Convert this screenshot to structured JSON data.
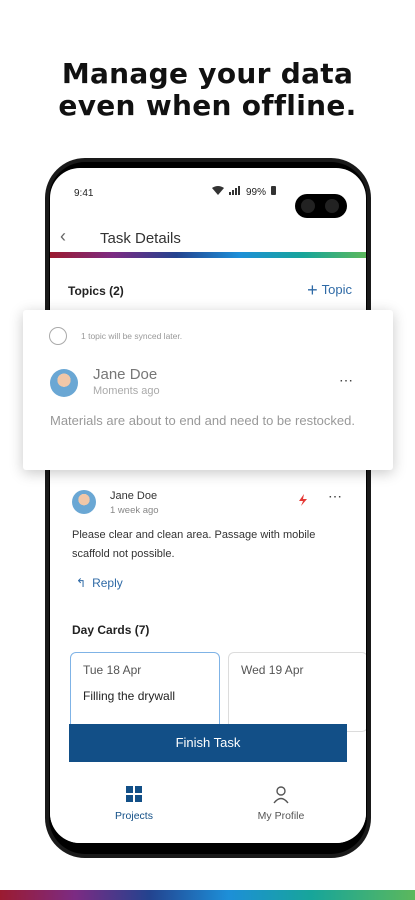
{
  "headline": {
    "line1": "Manage your data",
    "line2": "even when offline."
  },
  "status": {
    "time": "9:41",
    "battery": "99%"
  },
  "appbar": {
    "title": "Task Details"
  },
  "topics": {
    "label": "Topics (2)",
    "add_label": "Topic"
  },
  "offline_comment": {
    "sync_notice": "1 topic will be synced later.",
    "author": "Jane Doe",
    "time": "Moments ago",
    "text": "Materials are about to end and need to be restocked."
  },
  "comment": {
    "author": "Jane Doe",
    "time": "1 week ago",
    "text": "Please clear and clean area. Passage with mobile scaffold not possible.",
    "reply_label": "Reply"
  },
  "day_cards": {
    "label": "Day Cards (7)",
    "items": [
      {
        "date": "Tue 18 Apr",
        "title": "Filling the drywall"
      },
      {
        "date": "Wed 19 Apr",
        "title": ""
      }
    ]
  },
  "finish_button": "Finish Task",
  "bottom_nav": {
    "projects": "Projects",
    "profile": "My Profile"
  },
  "colors": {
    "primary": "#124f87",
    "link": "#2f6aa6",
    "flag": "#e53935"
  }
}
